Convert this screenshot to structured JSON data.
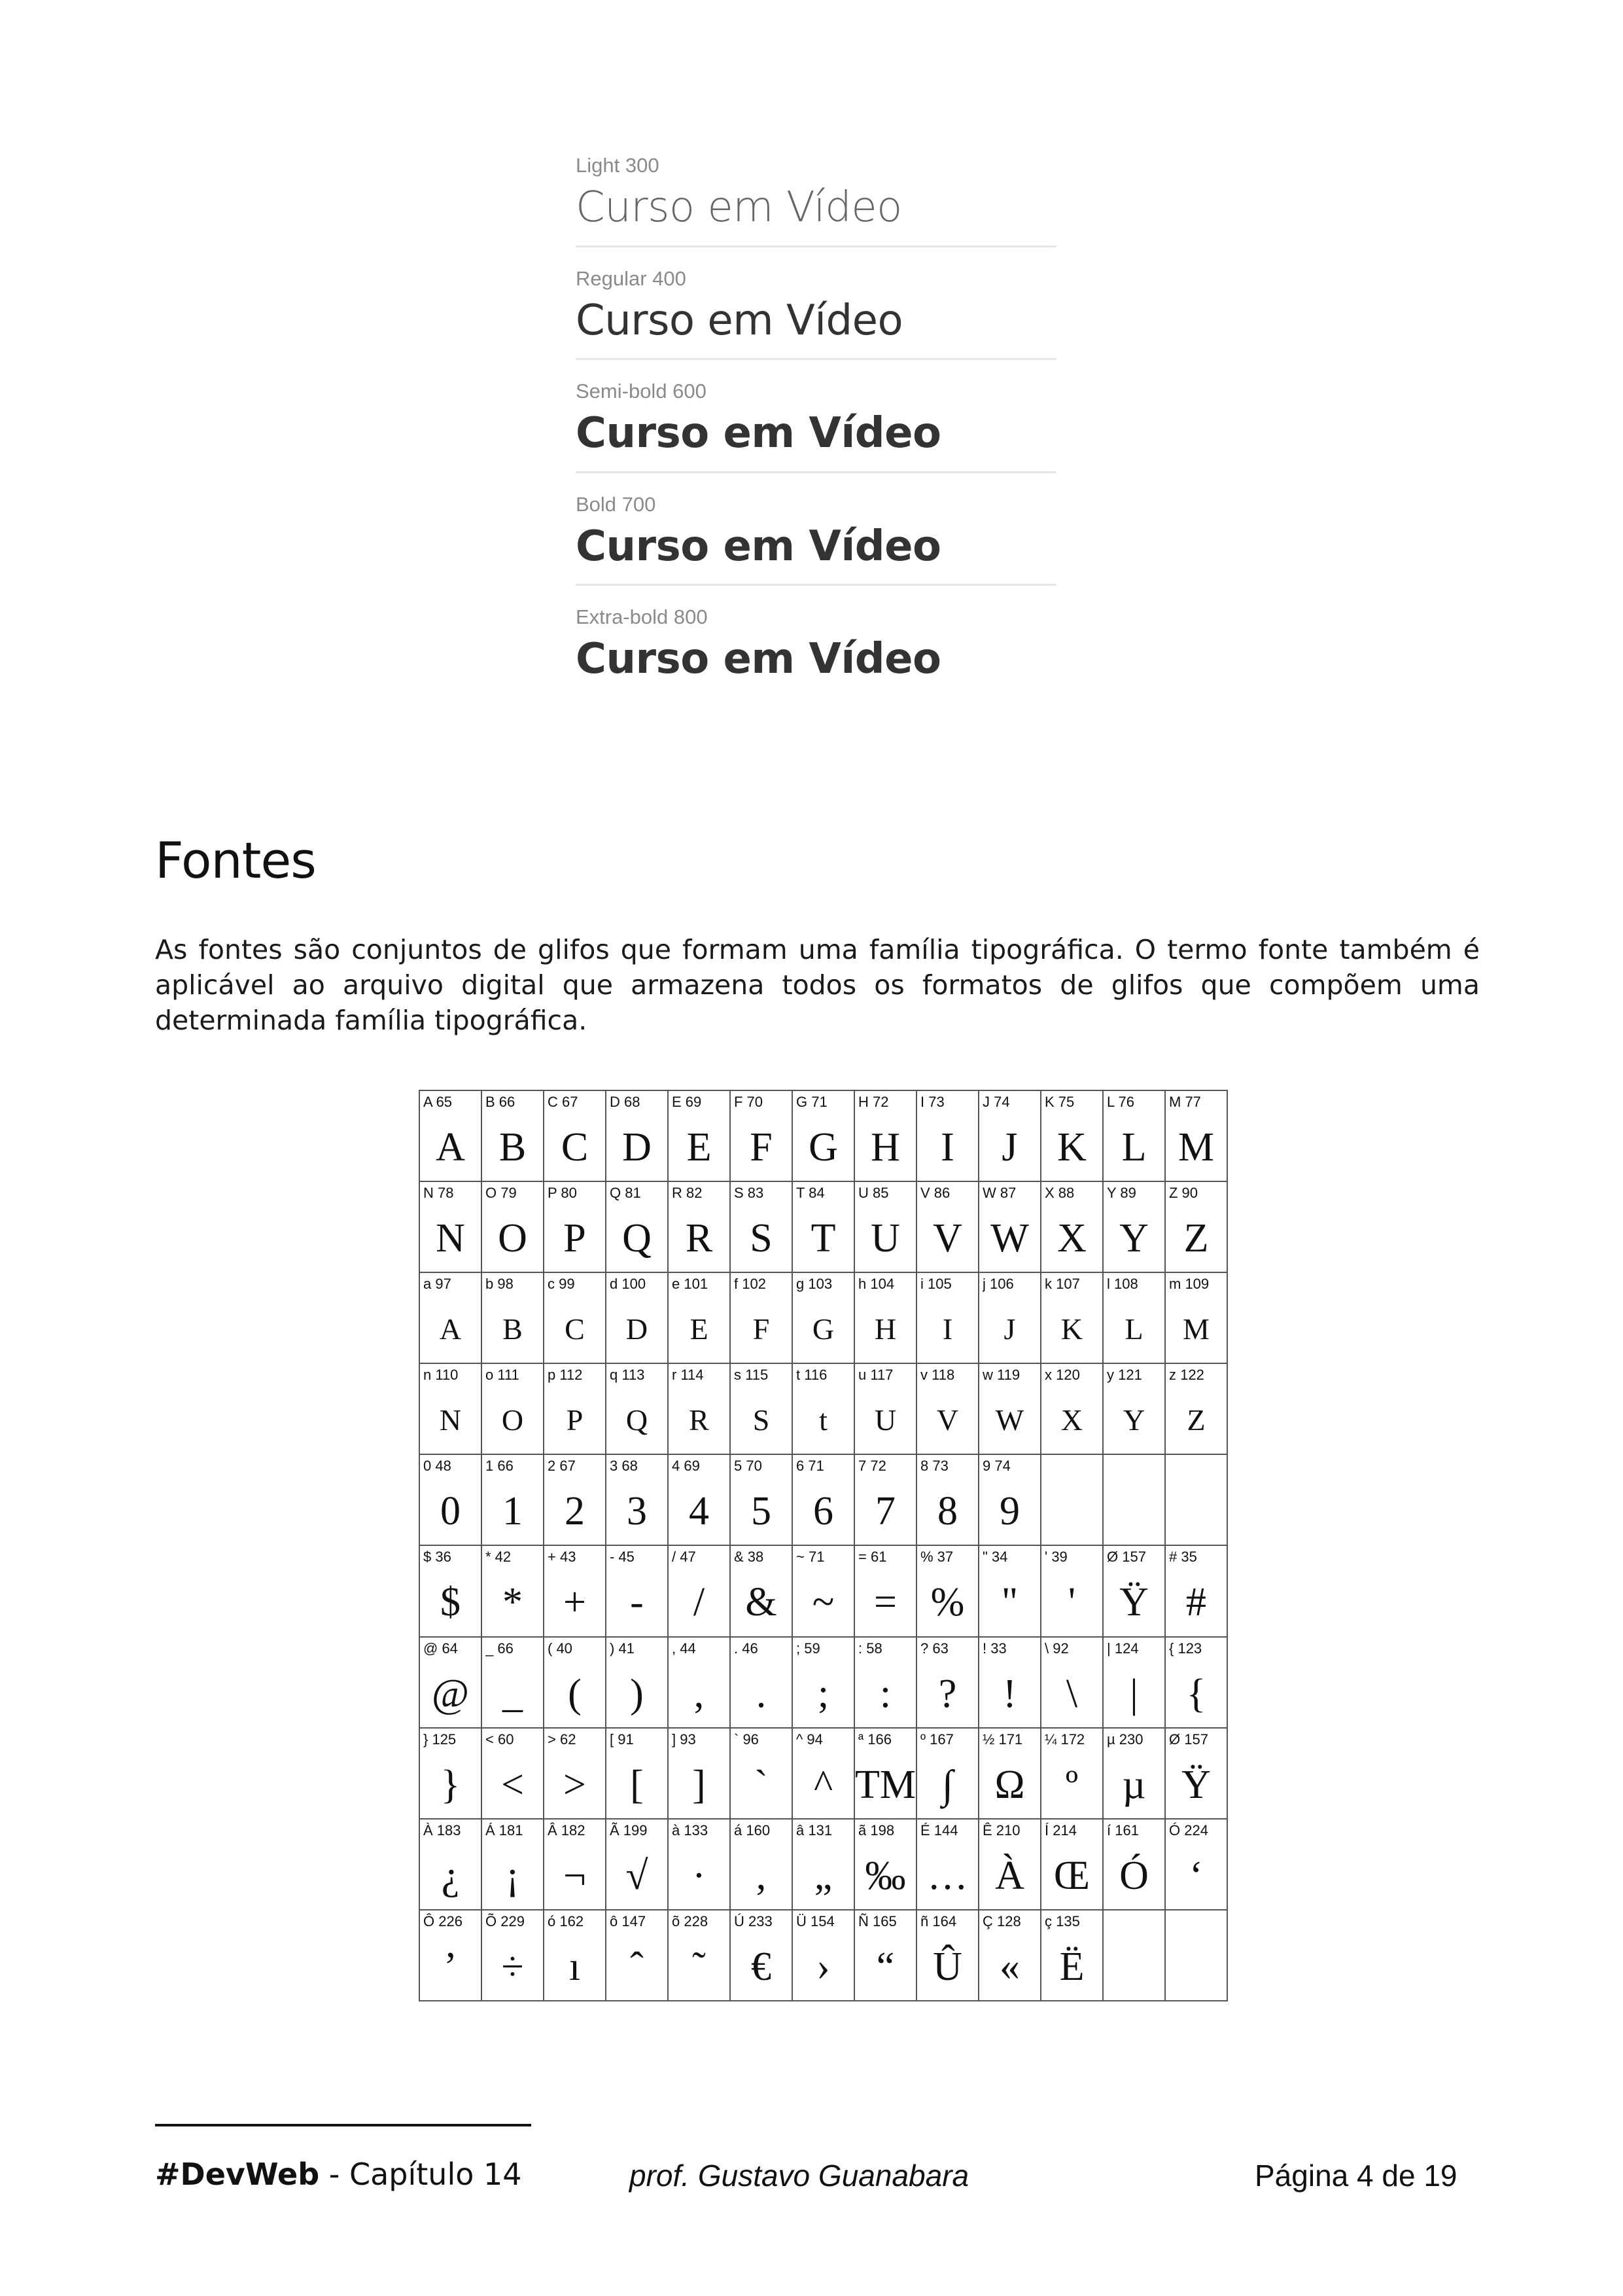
{
  "weights": [
    {
      "label": "Light 300",
      "sample": "Curso em Vídeo"
    },
    {
      "label": "Regular 400",
      "sample": "Curso em Vídeo"
    },
    {
      "label": "Semi-bold 600",
      "sample": "Curso em Vídeo"
    },
    {
      "label": "Bold 700",
      "sample": "Curso em Vídeo"
    },
    {
      "label": "Extra-bold 800",
      "sample": "Curso em Vídeo"
    }
  ],
  "section": {
    "title": "Fontes",
    "paragraph": "As fontes são conjuntos de glifos que formam uma família tipográfica. O termo fonte também é aplicável ao arquivo digital que armazena todos os formatos de glifos que compõem uma determinada família tipográfica."
  },
  "glyph_table": {
    "rows": [
      [
        {
          "code": "A 65",
          "glyph": "A"
        },
        {
          "code": "B 66",
          "glyph": "B"
        },
        {
          "code": "C 67",
          "glyph": "C"
        },
        {
          "code": "D 68",
          "glyph": "D"
        },
        {
          "code": "E 69",
          "glyph": "E"
        },
        {
          "code": "F 70",
          "glyph": "F"
        },
        {
          "code": "G 71",
          "glyph": "G"
        },
        {
          "code": "H 72",
          "glyph": "H"
        },
        {
          "code": "I 73",
          "glyph": "I"
        },
        {
          "code": "J 74",
          "glyph": "J"
        },
        {
          "code": "K 75",
          "glyph": "K"
        },
        {
          "code": "L 76",
          "glyph": "L"
        },
        {
          "code": "M 77",
          "glyph": "M"
        }
      ],
      [
        {
          "code": "N 78",
          "glyph": "N"
        },
        {
          "code": "O 79",
          "glyph": "O"
        },
        {
          "code": "P 80",
          "glyph": "P"
        },
        {
          "code": "Q 81",
          "glyph": "Q"
        },
        {
          "code": "R 82",
          "glyph": "R"
        },
        {
          "code": "S 83",
          "glyph": "S"
        },
        {
          "code": "T 84",
          "glyph": "T"
        },
        {
          "code": "U 85",
          "glyph": "U"
        },
        {
          "code": "V 86",
          "glyph": "V"
        },
        {
          "code": "W 87",
          "glyph": "W"
        },
        {
          "code": "X 88",
          "glyph": "X"
        },
        {
          "code": "Y 89",
          "glyph": "Y"
        },
        {
          "code": "Z 90",
          "glyph": "Z"
        }
      ],
      [
        {
          "code": "a 97",
          "glyph": "A"
        },
        {
          "code": "b 98",
          "glyph": "B"
        },
        {
          "code": "c 99",
          "glyph": "C"
        },
        {
          "code": "d 100",
          "glyph": "D"
        },
        {
          "code": "e 101",
          "glyph": "E"
        },
        {
          "code": "f 102",
          "glyph": "F"
        },
        {
          "code": "g 103",
          "glyph": "G"
        },
        {
          "code": "h 104",
          "glyph": "H"
        },
        {
          "code": "i 105",
          "glyph": "I"
        },
        {
          "code": "j 106",
          "glyph": "J"
        },
        {
          "code": "k 107",
          "glyph": "K"
        },
        {
          "code": "l 108",
          "glyph": "L"
        },
        {
          "code": "m 109",
          "glyph": "M"
        }
      ],
      [
        {
          "code": "n 110",
          "glyph": "N"
        },
        {
          "code": "o 111",
          "glyph": "O"
        },
        {
          "code": "p 112",
          "glyph": "P"
        },
        {
          "code": "q 113",
          "glyph": "Q"
        },
        {
          "code": "r 114",
          "glyph": "R"
        },
        {
          "code": "s 115",
          "glyph": "S"
        },
        {
          "code": "t 116",
          "glyph": "t"
        },
        {
          "code": "u 117",
          "glyph": "U"
        },
        {
          "code": "v 118",
          "glyph": "V"
        },
        {
          "code": "w 119",
          "glyph": "W"
        },
        {
          "code": "x 120",
          "glyph": "X"
        },
        {
          "code": "y 121",
          "glyph": "Y"
        },
        {
          "code": "z 122",
          "glyph": "Z"
        }
      ],
      [
        {
          "code": "0 48",
          "glyph": "0"
        },
        {
          "code": "1 66",
          "glyph": "1"
        },
        {
          "code": "2 67",
          "glyph": "2"
        },
        {
          "code": "3 68",
          "glyph": "3"
        },
        {
          "code": "4 69",
          "glyph": "4"
        },
        {
          "code": "5 70",
          "glyph": "5"
        },
        {
          "code": "6 71",
          "glyph": "6"
        },
        {
          "code": "7 72",
          "glyph": "7"
        },
        {
          "code": "8 73",
          "glyph": "8"
        },
        {
          "code": "9 74",
          "glyph": "9"
        },
        {
          "code": "",
          "glyph": ""
        },
        {
          "code": "",
          "glyph": ""
        },
        {
          "code": "",
          "glyph": ""
        }
      ],
      [
        {
          "code": "$ 36",
          "glyph": "$"
        },
        {
          "code": "* 42",
          "glyph": "*"
        },
        {
          "code": "+ 43",
          "glyph": "+"
        },
        {
          "code": "- 45",
          "glyph": "-"
        },
        {
          "code": "/ 47",
          "glyph": "/"
        },
        {
          "code": "& 38",
          "glyph": "&"
        },
        {
          "code": "~ 71",
          "glyph": "~"
        },
        {
          "code": "= 61",
          "glyph": "="
        },
        {
          "code": "% 37",
          "glyph": "%"
        },
        {
          "code": "\" 34",
          "glyph": "\""
        },
        {
          "code": "' 39",
          "glyph": "'"
        },
        {
          "code": "Ø 157",
          "glyph": "Ÿ"
        },
        {
          "code": "# 35",
          "glyph": "#"
        }
      ],
      [
        {
          "code": "@ 64",
          "glyph": "@"
        },
        {
          "code": "_ 66",
          "glyph": "_"
        },
        {
          "code": "( 40",
          "glyph": "("
        },
        {
          "code": ") 41",
          "glyph": ")"
        },
        {
          "code": ", 44",
          "glyph": ","
        },
        {
          "code": ". 46",
          "glyph": "."
        },
        {
          "code": "; 59",
          "glyph": ";"
        },
        {
          "code": ": 58",
          "glyph": ":"
        },
        {
          "code": "? 63",
          "glyph": "?"
        },
        {
          "code": "! 33",
          "glyph": "!"
        },
        {
          "code": "\\ 92",
          "glyph": "\\"
        },
        {
          "code": "| 124",
          "glyph": "|"
        },
        {
          "code": "{ 123",
          "glyph": "{"
        }
      ],
      [
        {
          "code": "} 125",
          "glyph": "}"
        },
        {
          "code": "< 60",
          "glyph": "<"
        },
        {
          "code": "> 62",
          "glyph": ">"
        },
        {
          "code": "[ 91",
          "glyph": "["
        },
        {
          "code": "] 93",
          "glyph": "]"
        },
        {
          "code": "` 96",
          "glyph": "`"
        },
        {
          "code": "^ 94",
          "glyph": "^"
        },
        {
          "code": "ª 166",
          "glyph": "TM"
        },
        {
          "code": "º 167",
          "glyph": "∫"
        },
        {
          "code": "½ 171",
          "glyph": "Ω"
        },
        {
          "code": "¼ 172",
          "glyph": "º"
        },
        {
          "code": "µ 230",
          "glyph": "µ"
        },
        {
          "code": "Ø 157",
          "glyph": "Ÿ"
        }
      ],
      [
        {
          "code": "À 183",
          "glyph": "¿"
        },
        {
          "code": "Á 181",
          "glyph": "¡"
        },
        {
          "code": "Â 182",
          "glyph": "¬"
        },
        {
          "code": "Ã 199",
          "glyph": "√"
        },
        {
          "code": "à 133",
          "glyph": "·"
        },
        {
          "code": "á 160",
          "glyph": ","
        },
        {
          "code": "â 131",
          "glyph": "„"
        },
        {
          "code": "ã 198",
          "glyph": "‰"
        },
        {
          "code": "É 144",
          "glyph": "…"
        },
        {
          "code": "Ê 210",
          "glyph": "À"
        },
        {
          "code": "Í 214",
          "glyph": "Œ"
        },
        {
          "code": "í 161",
          "glyph": "Ó"
        },
        {
          "code": "Ó 224",
          "glyph": "‘"
        }
      ],
      [
        {
          "code": "Ô 226",
          "glyph": "’"
        },
        {
          "code": "Õ 229",
          "glyph": "÷"
        },
        {
          "code": "ó 162",
          "glyph": "ı"
        },
        {
          "code": "ô 147",
          "glyph": "ˆ"
        },
        {
          "code": "õ 228",
          "glyph": "˜"
        },
        {
          "code": "Ú 233",
          "glyph": "€"
        },
        {
          "code": "Ü 154",
          "glyph": "›"
        },
        {
          "code": "Ñ 165",
          "glyph": "“"
        },
        {
          "code": "ñ 164",
          "glyph": "Û"
        },
        {
          "code": "Ç 128",
          "glyph": "«"
        },
        {
          "code": "ç 135",
          "glyph": "Ë"
        },
        {
          "code": "",
          "glyph": ""
        },
        {
          "code": "",
          "glyph": ""
        }
      ]
    ]
  },
  "footer": {
    "brand": "#DevWeb",
    "chapter": " - Capítulo 14",
    "author": "prof. Gustavo Guanabara",
    "page": "Página 4 de 19"
  }
}
